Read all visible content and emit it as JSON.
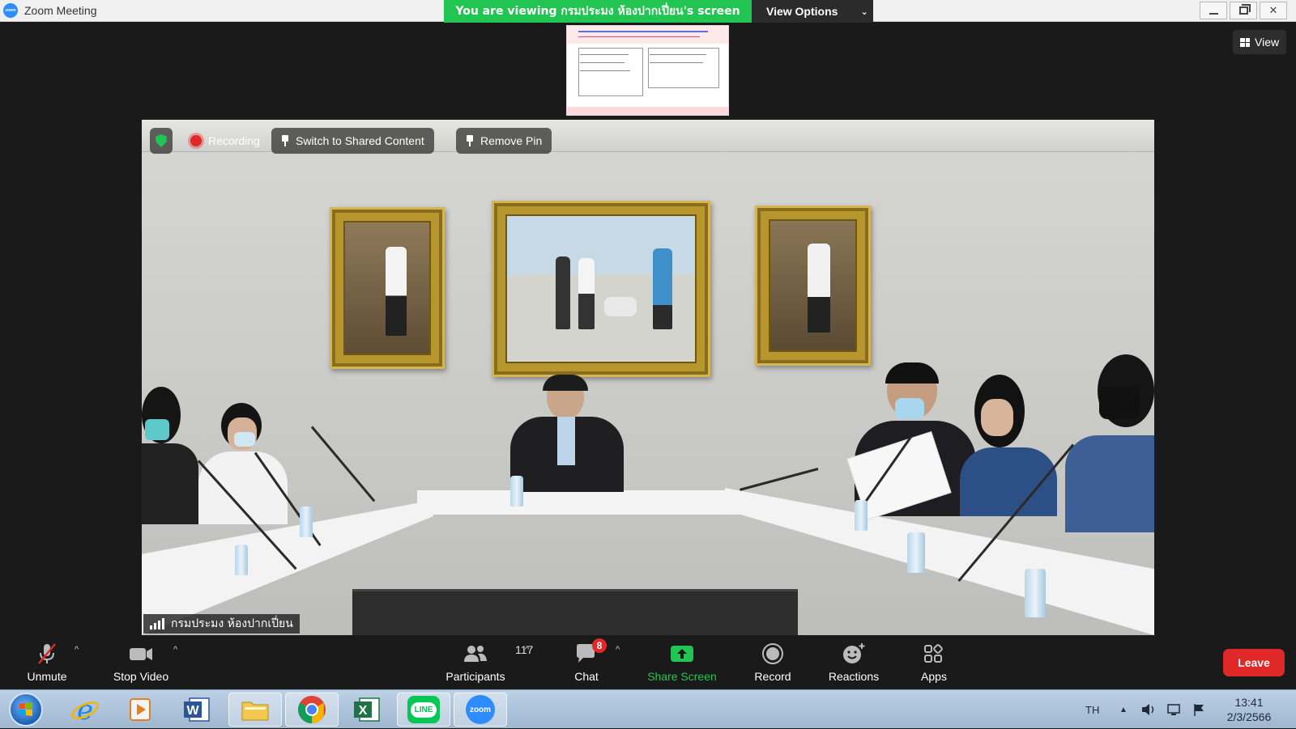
{
  "window": {
    "title": "Zoom Meeting",
    "logo_text": "zoom"
  },
  "banner": {
    "viewing_text": "You are viewing กรมประมง ห้องปากเปี่ยน's screen",
    "view_options_label": "View Options"
  },
  "view_button_label": "View",
  "video": {
    "chips": {
      "recording_label": "Recording",
      "switch_label": "Switch to Shared Content",
      "remove_pin_label": "Remove Pin"
    },
    "participant_name": "กรมประมง ห้องปากเปี่ยน"
  },
  "toolbar": {
    "unmute_label": "Unmute",
    "stop_video_label": "Stop Video",
    "participants_label": "Participants",
    "participants_count": "117",
    "chat_label": "Chat",
    "chat_badge": "8",
    "share_label": "Share Screen",
    "record_label": "Record",
    "reactions_label": "Reactions",
    "apps_label": "Apps",
    "leave_label": "Leave"
  },
  "taskbar": {
    "language": "TH",
    "time": "13:41",
    "date": "2/3/2566",
    "line_label": "LINE",
    "zoom_label": "zoom"
  },
  "colors": {
    "share_green": "#23c552",
    "leave_red": "#e02828",
    "zoom_blue": "#2d8cff"
  }
}
